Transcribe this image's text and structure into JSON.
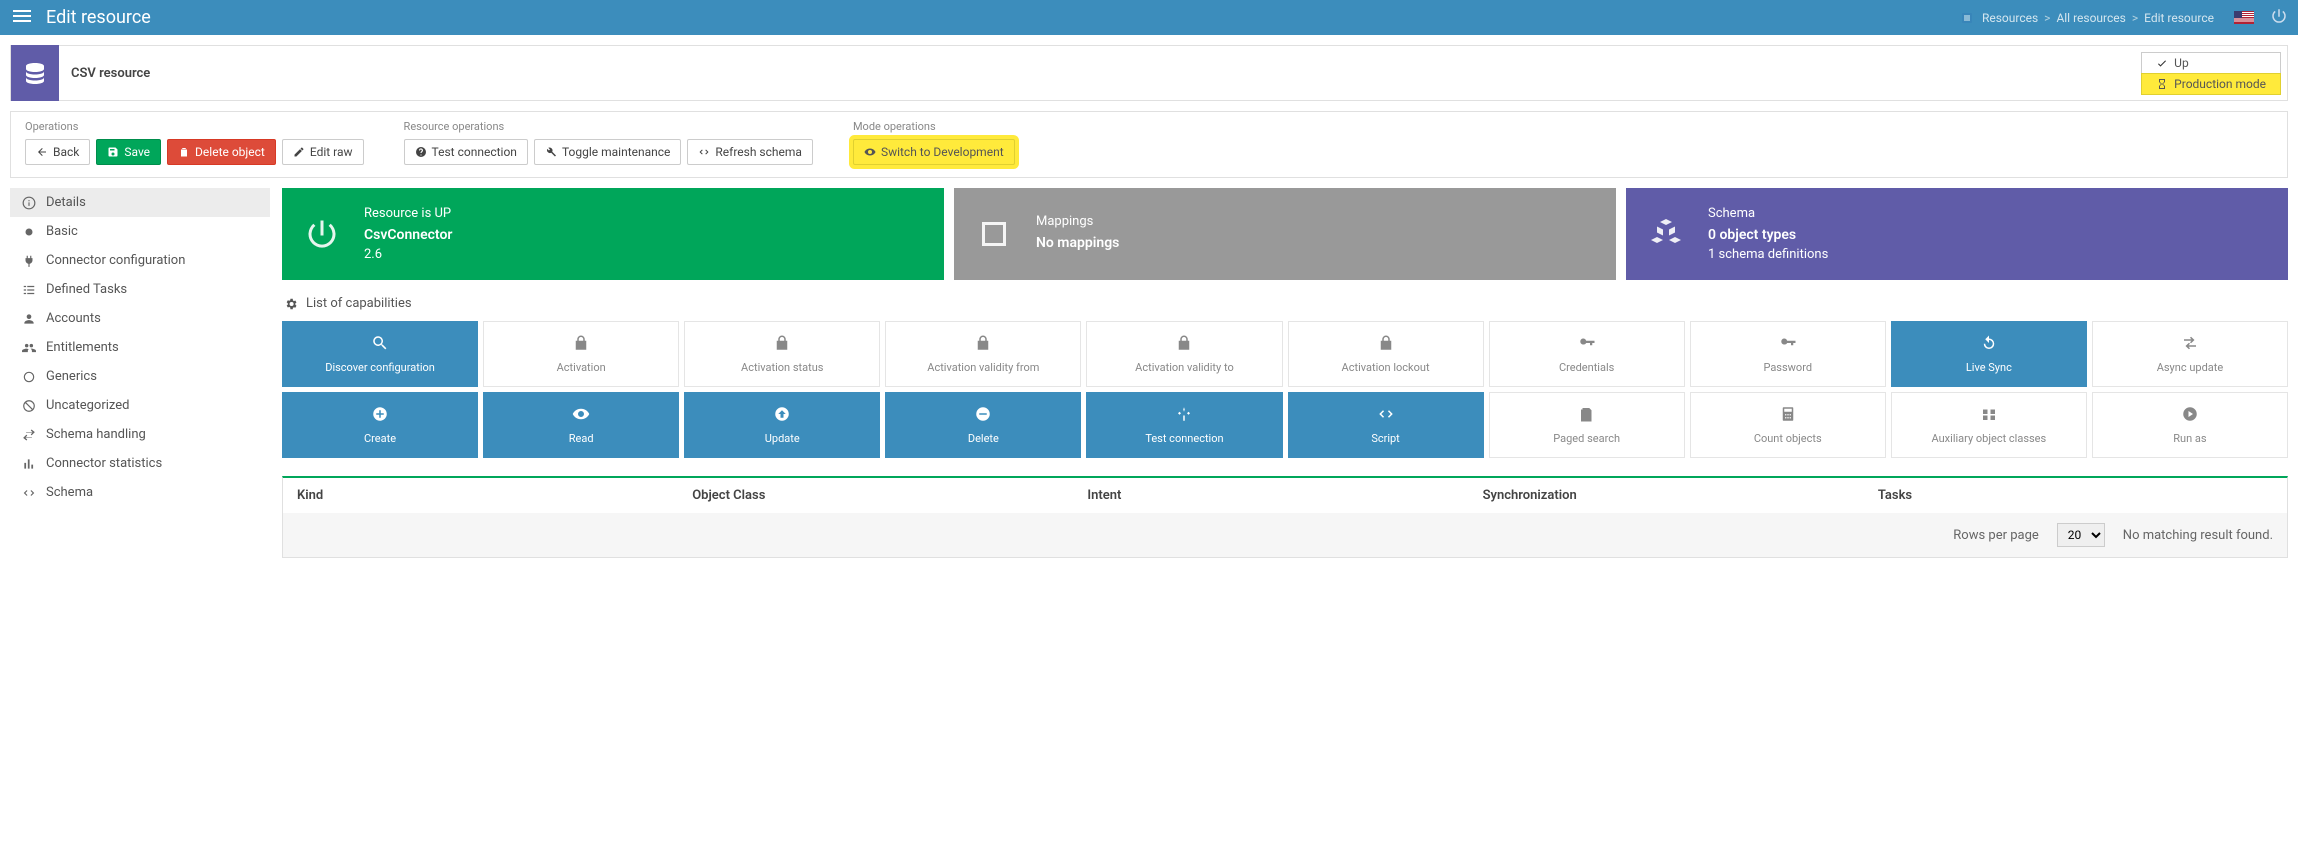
{
  "topbar": {
    "title": "Edit resource",
    "breadcrumb": [
      "Resources",
      "All resources",
      "Edit resource"
    ]
  },
  "resource": {
    "name": "CSV resource",
    "status_up": "Up",
    "status_mode": "Production mode"
  },
  "ops": {
    "operations_label": "Operations",
    "back": "Back",
    "save": "Save",
    "delete_object": "Delete object",
    "edit_raw": "Edit raw",
    "resource_ops_label": "Resource operations",
    "test_connection": "Test connection",
    "toggle_maintenance": "Toggle maintenance",
    "refresh_schema": "Refresh schema",
    "mode_ops_label": "Mode operations",
    "switch_dev": "Switch to Development"
  },
  "sidebar": {
    "items": [
      {
        "label": "Details",
        "icon": "info"
      },
      {
        "label": "Basic",
        "icon": "circle"
      },
      {
        "label": "Connector configuration",
        "icon": "plug"
      },
      {
        "label": "Defined Tasks",
        "icon": "tasks"
      },
      {
        "label": "Accounts",
        "icon": "user"
      },
      {
        "label": "Entitlements",
        "icon": "users"
      },
      {
        "label": "Generics",
        "icon": "ring"
      },
      {
        "label": "Uncategorized",
        "icon": "ban"
      },
      {
        "label": "Schema handling",
        "icon": "exchange"
      },
      {
        "label": "Connector statistics",
        "icon": "bars"
      },
      {
        "label": "Schema",
        "icon": "code"
      }
    ]
  },
  "cards": {
    "resource": {
      "title": "Resource is UP",
      "name": "CsvConnector",
      "version": "2.6"
    },
    "mappings": {
      "title": "Mappings",
      "text": "No mappings"
    },
    "schema": {
      "title": "Schema",
      "line1": "0 object types",
      "line2": "1 schema definitions"
    }
  },
  "capabilities": {
    "header": "List of capabilities",
    "tiles": [
      {
        "label": "Discover configuration",
        "icon": "search",
        "active": true
      },
      {
        "label": "Activation",
        "icon": "lock",
        "active": false
      },
      {
        "label": "Activation status",
        "icon": "lock",
        "active": false
      },
      {
        "label": "Activation validity from",
        "icon": "lock",
        "active": false
      },
      {
        "label": "Activation validity to",
        "icon": "lock",
        "active": false
      },
      {
        "label": "Activation lockout",
        "icon": "lock",
        "active": false
      },
      {
        "label": "Credentials",
        "icon": "key",
        "active": false
      },
      {
        "label": "Password",
        "icon": "key",
        "active": false
      },
      {
        "label": "Live Sync",
        "icon": "refresh",
        "active": true
      },
      {
        "label": "Async update",
        "icon": "async",
        "active": false
      },
      {
        "label": "Create",
        "icon": "plus",
        "active": true
      },
      {
        "label": "Read",
        "icon": "eye",
        "active": true
      },
      {
        "label": "Update",
        "icon": "up",
        "active": true
      },
      {
        "label": "Delete",
        "icon": "minus",
        "active": true
      },
      {
        "label": "Test connection",
        "icon": "signal",
        "active": true
      },
      {
        "label": "Script",
        "icon": "code",
        "active": true
      },
      {
        "label": "Paged search",
        "icon": "pages",
        "active": false
      },
      {
        "label": "Count objects",
        "icon": "calc",
        "active": false
      },
      {
        "label": "Auxiliary object classes",
        "icon": "aux",
        "active": false
      },
      {
        "label": "Run as",
        "icon": "play",
        "active": false
      }
    ]
  },
  "table": {
    "columns": [
      "Kind",
      "Object Class",
      "Intent",
      "Synchronization",
      "Tasks"
    ],
    "rows_per_page_label": "Rows per page",
    "rows_per_page_value": "20",
    "empty_text": "No matching result found."
  }
}
